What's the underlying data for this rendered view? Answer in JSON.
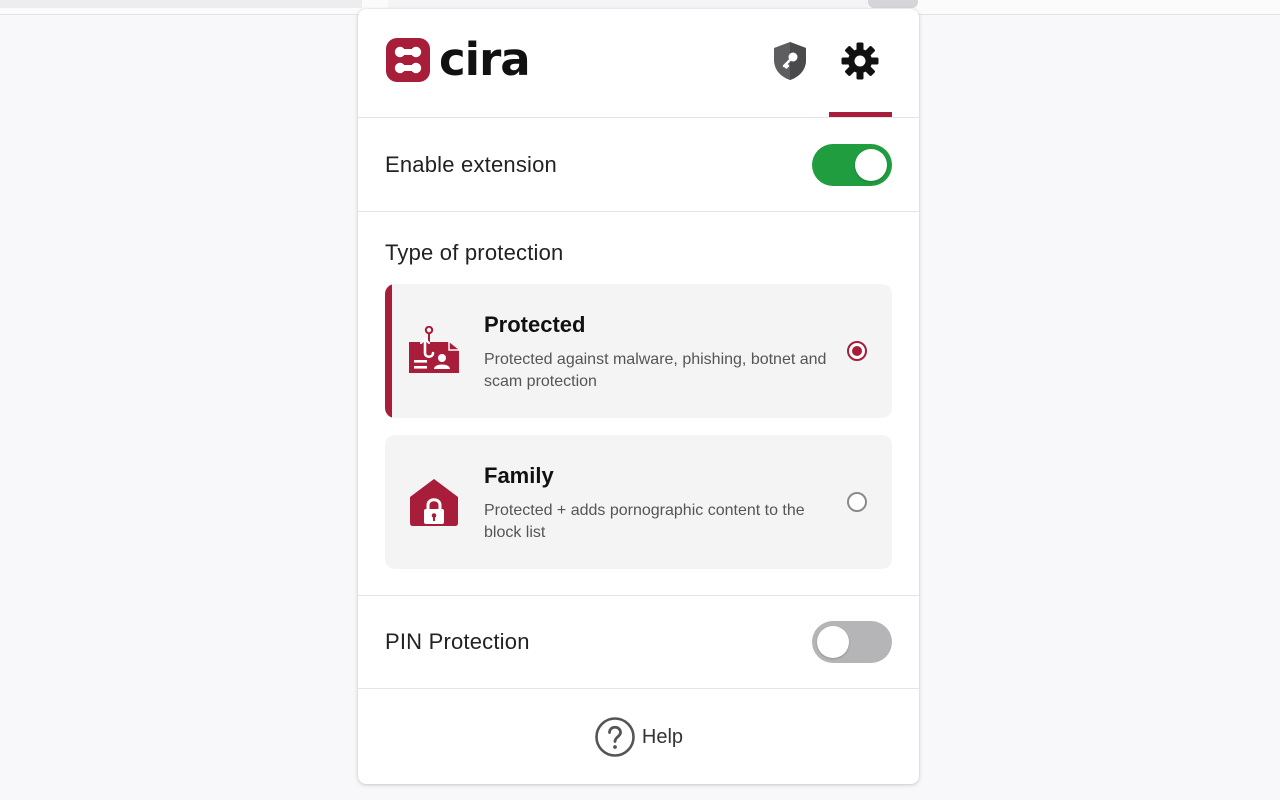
{
  "brand": {
    "name": "cira",
    "accent": "#a81d3a",
    "toggle_on_color": "#1f9d3f"
  },
  "header": {
    "icons": [
      "shield-key-icon",
      "gear-icon"
    ],
    "active_tab": "settings"
  },
  "enable": {
    "label": "Enable extension",
    "state": "on"
  },
  "protection": {
    "title": "Type of protection",
    "options": [
      {
        "title": "Protected",
        "description": "Protected against malware, phishing, botnet and scam protection",
        "icon": "phishing-id-icon",
        "selected": true
      },
      {
        "title": "Family",
        "description": "Protected + adds pornographic content to the block list",
        "icon": "house-lock-icon",
        "selected": false
      }
    ]
  },
  "pin": {
    "label": "PIN Protection",
    "state": "off"
  },
  "help": {
    "label": "Help"
  }
}
